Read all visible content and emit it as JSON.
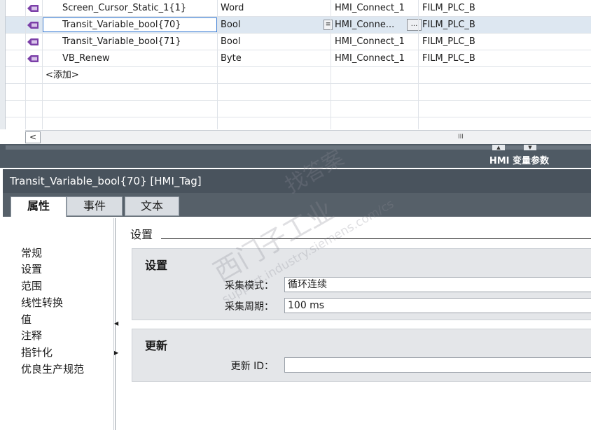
{
  "table": {
    "rows": [
      {
        "name": "Screen_Cursor_Static_1{1}",
        "type": "Word",
        "connection": "HMI_Connect_1",
        "plc": "FILM_PLC_B"
      },
      {
        "name": "Transit_Variable_bool{70}",
        "type": "Bool",
        "connection": "HMI_Conne...",
        "plc": "FILM_PLC_B"
      },
      {
        "name": "Transit_Variable_bool{71}",
        "type": "Bool",
        "connection": "HMI_Connect_1",
        "plc": "FILM_PLC_B"
      },
      {
        "name": "VB_Renew",
        "type": "Byte",
        "connection": "HMI_Connect_1",
        "plc": "FILM_PLC_B"
      }
    ],
    "add_row": "<添加>",
    "ellipsis_button": "...",
    "scroll_left": "<",
    "scroll_grip": "III"
  },
  "splitter": {
    "label": "HMI 变量参数"
  },
  "inspector": {
    "title": "Transit_Variable_bool{70} [HMI_Tag]",
    "tabs": [
      "属性",
      "事件",
      "文本"
    ],
    "nav": [
      "常规",
      "设置",
      "范围",
      "线性转换",
      "值",
      "注释",
      "指针化",
      "优良生产规范"
    ],
    "section_title": "设置",
    "settings_group": {
      "title": "设置",
      "acq_mode_label": "采集模式：",
      "acq_mode_value": "循环连续",
      "acq_cycle_label": "采集周期：",
      "acq_cycle_value": "100 ms"
    },
    "update_group": {
      "title": "更新",
      "update_id_label": "更新 ID：",
      "update_id_value": ""
    }
  },
  "watermark": {
    "line1": "找答案",
    "line2": "西门子工业",
    "line3": "support.industry.siemens.com/cs"
  },
  "colors": {
    "selection": "#dde7f1",
    "edit_border": "#3d7fd6",
    "dark_panel": "#49535d"
  }
}
